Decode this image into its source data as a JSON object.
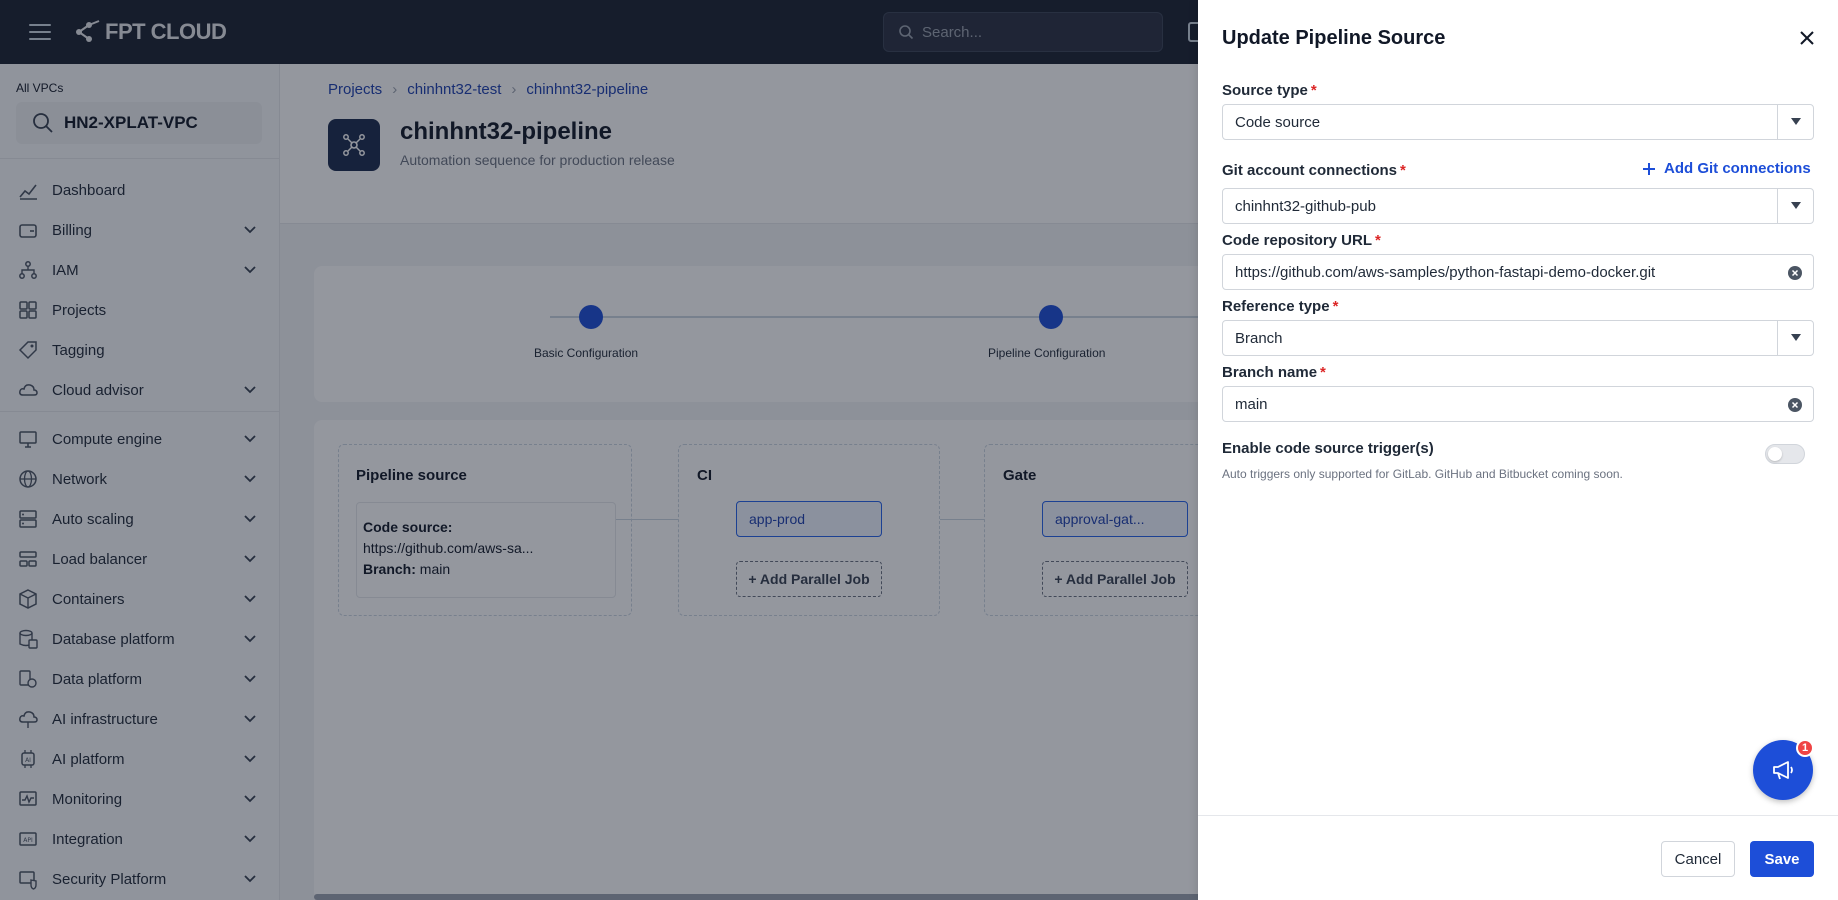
{
  "app": {
    "logo_text": "FPT CLOUD",
    "search_placeholder": "Search..."
  },
  "sidebar": {
    "vpc_label": "All VPCs",
    "vpc_name": "HN2-XPLAT-VPC",
    "items": [
      {
        "label": "Dashboard",
        "icon": "chart-icon",
        "expandable": false
      },
      {
        "label": "Billing",
        "icon": "wallet-icon",
        "expandable": true
      },
      {
        "label": "IAM",
        "icon": "hierarchy-icon",
        "expandable": true
      },
      {
        "label": "Projects",
        "icon": "grid-icon",
        "expandable": false
      },
      {
        "label": "Tagging",
        "icon": "tag-icon",
        "expandable": false
      },
      {
        "label": "Cloud advisor",
        "icon": "cloud-icon",
        "expandable": true
      },
      {
        "label": "Compute engine",
        "icon": "monitor-icon",
        "expandable": true
      },
      {
        "label": "Network",
        "icon": "globe-icon",
        "expandable": true
      },
      {
        "label": "Auto scaling",
        "icon": "server-icon",
        "expandable": true
      },
      {
        "label": "Load balancer",
        "icon": "balance-icon",
        "expandable": true
      },
      {
        "label": "Containers",
        "icon": "box-icon",
        "expandable": true
      },
      {
        "label": "Database platform",
        "icon": "database-icon",
        "expandable": true
      },
      {
        "label": "Data platform",
        "icon": "data-icon",
        "expandable": true
      },
      {
        "label": "AI infrastructure",
        "icon": "cloud-ai-icon",
        "expandable": true
      },
      {
        "label": "AI platform",
        "icon": "ai-chip-icon",
        "expandable": true
      },
      {
        "label": "Monitoring",
        "icon": "pulse-icon",
        "expandable": true
      },
      {
        "label": "Integration",
        "icon": "api-icon",
        "expandable": true
      },
      {
        "label": "Security Platform",
        "icon": "shield-icon",
        "expandable": true
      }
    ]
  },
  "breadcrumb": [
    "Projects",
    "chinhnt32-test",
    "chinhnt32-pipeline"
  ],
  "page": {
    "title": "chinhnt32-pipeline",
    "subtitle": "Automation sequence for production release"
  },
  "steps": [
    {
      "label": "Basic Configuration"
    },
    {
      "label": "Pipeline Configuration"
    }
  ],
  "flow": {
    "source_stage": {
      "title": "Pipeline source",
      "code_source_label": "Code source:",
      "code_source_value": "https://github.com/aws-sa...",
      "branch_label": "Branch:",
      "branch_value": "main"
    },
    "ci_stage": {
      "title": "CI",
      "job": "app-prod",
      "add_label": "+ Add Parallel Job"
    },
    "gate_stage": {
      "title": "Gate",
      "job": "approval-gat...",
      "add_label": "+ Add Parallel Job"
    }
  },
  "drawer": {
    "title": "Update Pipeline Source",
    "source_type": {
      "label": "Source type",
      "value": "Code source"
    },
    "git_connections": {
      "label": "Git account connections",
      "value": "chinhnt32-github-pub",
      "add_label": "Add Git connections"
    },
    "repo_url": {
      "label": "Code repository URL",
      "value": "https://github.com/aws-samples/python-fastapi-demo-docker.git"
    },
    "reference_type": {
      "label": "Reference type",
      "value": "Branch"
    },
    "branch_name": {
      "label": "Branch name",
      "value": "main"
    },
    "trigger": {
      "label": "Enable code source trigger(s)",
      "hint": "Auto triggers only supported for GitLab. GitHub and Bitbucket coming soon.",
      "enabled": false
    },
    "cancel_label": "Cancel",
    "save_label": "Save",
    "notification_count": "1"
  },
  "colors": {
    "accent": "#1d4ed8",
    "topbar": "#1b2130",
    "required": "#dc2626"
  }
}
